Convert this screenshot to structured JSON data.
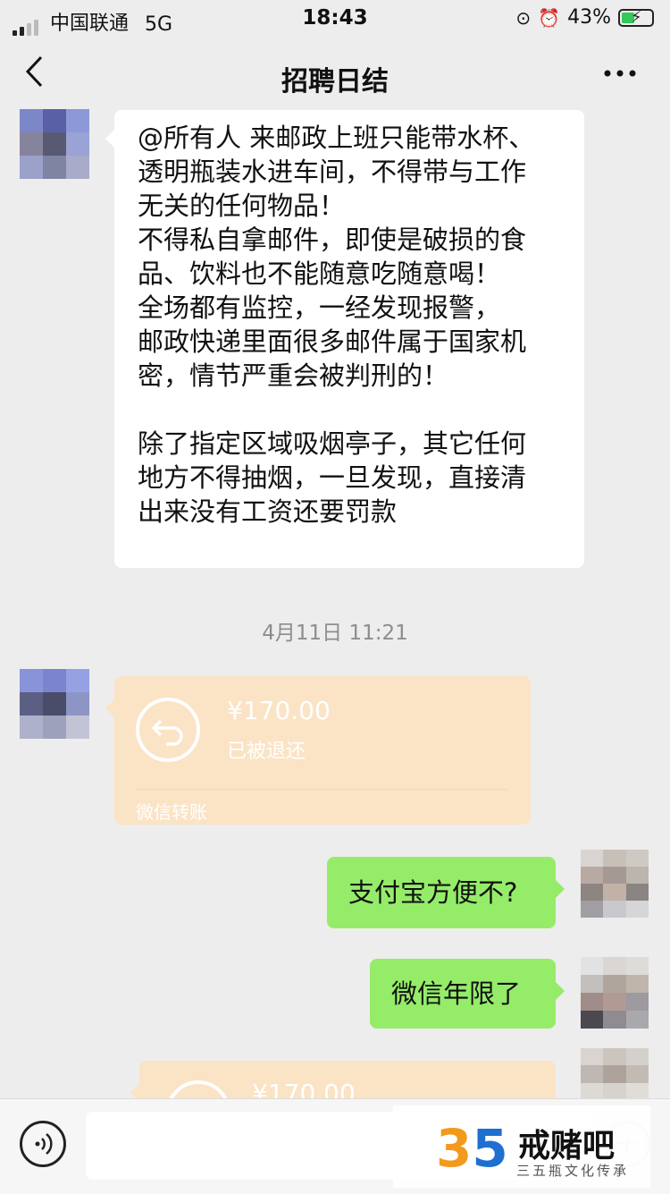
{
  "status_bar": {
    "carrier": "中国联通",
    "network": "5G",
    "time": "18:43",
    "battery": "43%"
  },
  "nav": {
    "back_icon": "chevron-left-icon",
    "title": "招聘日结",
    "more_icon": "more-dots-icon"
  },
  "messages": {
    "long_text": "@所有人 来邮政上班只能带水杯、\n透明瓶装水进车间，不得带与工作\n无关的任何物品！\n不得私自拿邮件，即使是破损的食\n品、饮料也不能随意吃随意喝！\n全场都有监控，一经发现报警，\n邮政快递里面很多邮件属于国家机\n密，情节严重会被判刑的！\n\n除了指定区域吸烟亭子，其它任何\n地方不得抽烟，一旦发现，直接清\n出来没有工资还要罚款",
    "timestamp": "4月11日 11:21",
    "transfer": {
      "amount": "¥170.00",
      "status": "已被退还",
      "label": "微信转账"
    },
    "reply1": "支付宝方便不?",
    "reply2": "微信年限了",
    "transfer2": {
      "amount": "¥170.00"
    }
  },
  "input_bar": {
    "voice_icon": "voice-icon",
    "plus_icon": "plus-icon"
  },
  "watermark": {
    "number_3": "3",
    "number_5": "5",
    "title": "戒赌吧",
    "subtitle": "三五瓶文化传承"
  },
  "colors": {
    "background": "#ededed",
    "transfer": "#fbe3c5",
    "sent_bubble": "#95ec69"
  }
}
